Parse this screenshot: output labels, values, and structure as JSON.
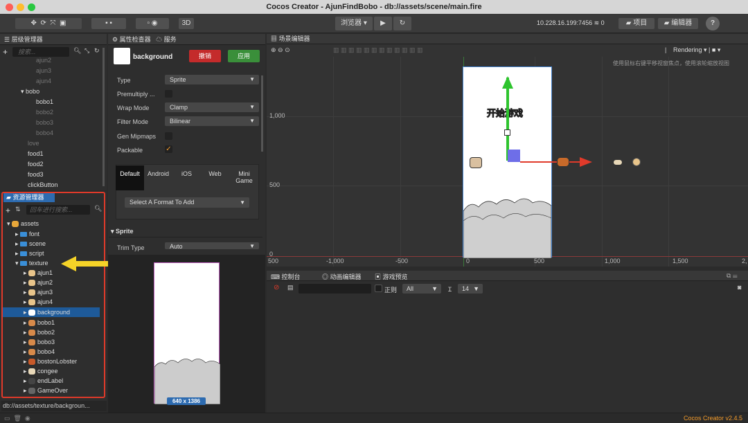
{
  "window": {
    "title": "Cocos Creator - AjunFindBobo - db://assets/scene/main.fire"
  },
  "toolbar": {
    "mode_3d": "3D",
    "browser_label": "浏览器 ▾",
    "play_icon": "▶",
    "refresh_icon": "↻",
    "ip": "10.228.16.199:7456",
    "connections": "0",
    "project_label": "项目",
    "editor_label": "编辑器",
    "help": "?"
  },
  "hierarchy": {
    "title": "层级管理器",
    "search_placeholder": "搜索...",
    "items": [
      "ajun2",
      "ajun3",
      "ajun4",
      "bobo",
      "bobo1",
      "bobo2",
      "bobo3",
      "bobo4",
      "love",
      "food1",
      "food2",
      "food3",
      "clickButton"
    ]
  },
  "assets": {
    "title": "资源管理器",
    "search_placeholder": "回车进行搜索...",
    "root": "assets",
    "folders": [
      "font",
      "scene",
      "script",
      "texture"
    ],
    "textures": [
      "ajun1",
      "ajun2",
      "ajun3",
      "ajun4",
      "background",
      "bobo1",
      "bobo2",
      "bobo3",
      "bobo4",
      "bostonLobster",
      "congee",
      "endLabel",
      "GameOver"
    ],
    "path": "db://assets/texture/backgroun..."
  },
  "inspector": {
    "title": "属性检查器",
    "services_tab": "服务",
    "asset_name": "background",
    "revert_label": "撤销",
    "apply_label": "应用",
    "props": [
      {
        "label": "Type",
        "value": "Sprite"
      },
      {
        "label": "Premultiply ...",
        "value": ""
      },
      {
        "label": "Wrap Mode",
        "value": "Clamp"
      },
      {
        "label": "Filter Mode",
        "value": "Bilinear"
      },
      {
        "label": "Gen Mipmaps",
        "value": ""
      },
      {
        "label": "Packable",
        "value": ""
      }
    ],
    "platform_tabs": [
      "Default",
      "Android",
      "iOS",
      "Web",
      "Mini Game"
    ],
    "format_select": "Select A Format To Add",
    "sprite_section": "▾ Sprite",
    "trim_label": "Trim Type",
    "trim_value": "Auto",
    "preview_size": "640 x 1386"
  },
  "scene_editor": {
    "title": "场景编辑器",
    "rendering": "Rendering",
    "hint": "使用鼠标右键平移视窗焦点，使用滚轮缩放视图",
    "y_labels": [
      "1,000",
      "500",
      "0"
    ],
    "x_labels": [
      "500",
      "-1,000",
      "-500",
      "0",
      "500",
      "1,000",
      "1,500",
      "2,"
    ],
    "game_title": "开始游戏"
  },
  "console": {
    "tabs": [
      "控制台",
      "动画编辑器",
      "游戏预览"
    ],
    "regex_label": "正则",
    "level": "All",
    "font_size": "14"
  },
  "status": {
    "version": "Cocos Creator v2.4.5"
  },
  "colors": {
    "accent_red": "#e03a2a",
    "select_blue": "#1e5a99",
    "arrow_yellow": "#f5d328"
  }
}
